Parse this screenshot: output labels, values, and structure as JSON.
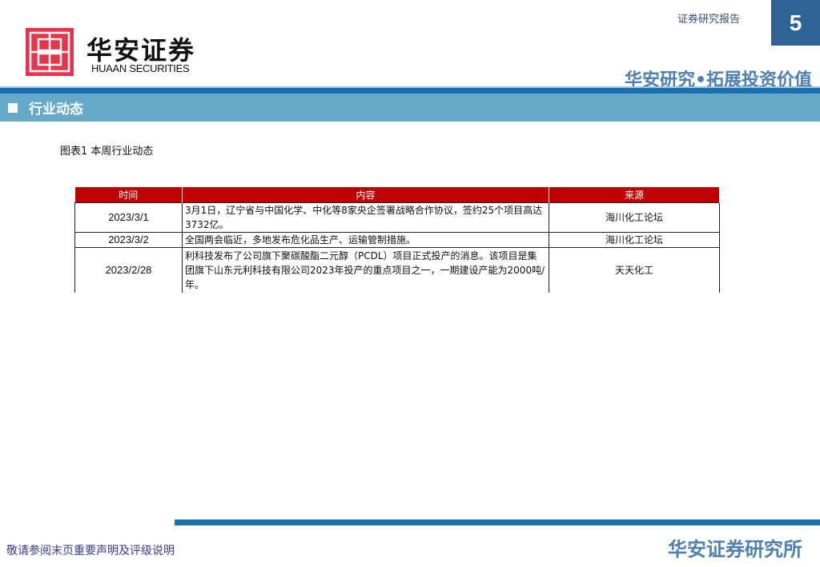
{
  "header": {
    "logo_cn": "华安证券",
    "logo_en": "HUAAN SECURITIES",
    "report_type": "证券研究报告",
    "page_number": "5",
    "slogan": "华安研究•拓展投资价值"
  },
  "section": {
    "title": "行业动态"
  },
  "caption": "图表1 本周行业动态",
  "table": {
    "headers": [
      "时间",
      "内容",
      "来源"
    ],
    "rows": [
      {
        "date": "2023/3/1",
        "content": "3月1日，辽宁省与中国化学、中化等8家央企签署战略合作协议，签约25个项目高达3732亿。",
        "source": "海川化工论坛"
      },
      {
        "date": "2023/3/2",
        "content": "全国两会临近，多地发布危化品生产、运输管制措施。",
        "source": "海川化工论坛"
      },
      {
        "date": "2023/2/28",
        "content": "利科技发布了公司旗下聚碳酸酯二元醇（PCDL）项目正式投产的消息。该项目是集团旗下山东元利科技有限公司2023年投产的重点项目之一，一期建设产能为2000吨/年。",
        "source": "天天化工"
      }
    ]
  },
  "footer": {
    "disclaimer": "敬请参阅末页重要声明及评级说明",
    "org": "华安证券研究所"
  },
  "colors": {
    "brand_red": "#e8344a",
    "table_header": "#c00000",
    "blue": "#1a6fb0",
    "section": "#65a8c8"
  }
}
